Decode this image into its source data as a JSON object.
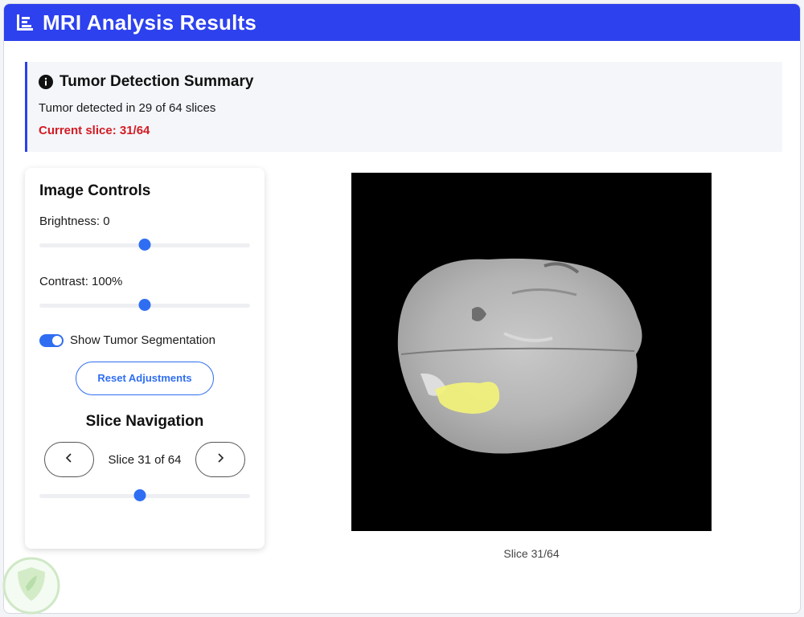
{
  "header": {
    "title": "MRI Analysis Results",
    "icon": "bar-chart-icon"
  },
  "summary": {
    "title": "Tumor Detection Summary",
    "icon": "info-icon",
    "detected_text": "Tumor detected in 29 of 64 slices",
    "current_slice_text": "Current slice: 31/64",
    "current_color": "#d31b22"
  },
  "controls": {
    "title": "Image Controls",
    "brightness_label": "Brightness: 0",
    "brightness_value": 0,
    "contrast_label": "Contrast: 100%",
    "contrast_value": 100,
    "segmentation_label": "Show Tumor Segmentation",
    "segmentation_on": true,
    "reset_label": "Reset Adjustments"
  },
  "navigation": {
    "title": "Slice Navigation",
    "slice_text": "Slice 31 of 64",
    "current_slice": 31,
    "total_slices": 64,
    "prev_icon": "chevron-left-icon",
    "next_icon": "chevron-right-icon"
  },
  "viewer": {
    "caption": "Slice 31/64"
  },
  "colors": {
    "accent": "#2f6ef2",
    "header": "#2d41ee",
    "segmentation": "#f2f27a"
  }
}
